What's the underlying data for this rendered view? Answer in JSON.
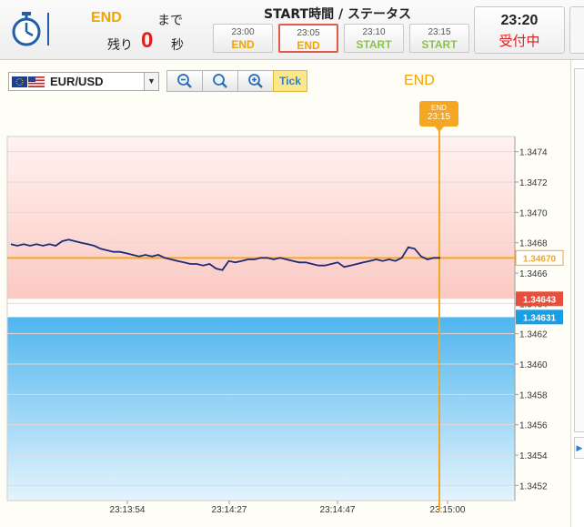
{
  "header": {
    "end_label": "END",
    "made": "まで",
    "nokori": "残り",
    "countdown": "0",
    "byou": "秒",
    "status_heading": "START時間 / ステータス",
    "slots": [
      {
        "time": "23:00",
        "status": "END",
        "kind": "end",
        "selected": false
      },
      {
        "time": "23:05",
        "status": "END",
        "kind": "end",
        "selected": true
      },
      {
        "time": "23:10",
        "status": "START",
        "kind": "start",
        "selected": false
      },
      {
        "time": "23:15",
        "status": "START",
        "kind": "start",
        "selected": false
      }
    ],
    "clock_time": "23:20",
    "clock_status": "受付中"
  },
  "chart_panel": {
    "pair": "EUR/USD",
    "tick_label": "Tick",
    "end_label": "END",
    "end_marker_top": "END",
    "end_marker_time": "23:15"
  },
  "colors": {
    "accent_orange": "#f5a623",
    "down_red": "#e84e3a",
    "up_blue": "#1a9ee3",
    "price_line": "#1e2a78"
  },
  "icons": [
    "stopwatch-icon",
    "zoom-out-icon",
    "zoom-reset-icon",
    "zoom-in-icon",
    "dropdown-arrow-icon",
    "us-flag-icon"
  ],
  "chart_data": {
    "type": "line",
    "title": "",
    "xlabel": "",
    "ylabel": "",
    "ylim": [
      1.3451,
      1.3475
    ],
    "yticks": [
      "1.3474",
      "1.3472",
      "1.3470",
      "1.3468",
      "1.3466",
      "1.3464",
      "1.3462",
      "1.3460",
      "1.3458",
      "1.3456",
      "1.3454",
      "1.3452"
    ],
    "xticks": [
      "23:13:54",
      "23:14:27",
      "23:14:47",
      "23:15:00"
    ],
    "current_price": "1.34670",
    "low_line_label": "1.34643",
    "high_line_label": "1.34631",
    "strike": 1.3467,
    "low_line": 1.34643,
    "high_line": 1.34631,
    "series": [
      {
        "values": [
          1.34679,
          1.34678,
          1.34679,
          1.34678,
          1.34679,
          1.34678,
          1.34679,
          1.34678,
          1.34681,
          1.34682,
          1.34681,
          1.3468,
          1.34679,
          1.34678,
          1.34676,
          1.34675,
          1.34674,
          1.34674,
          1.34673,
          1.34672,
          1.34671,
          1.34672,
          1.34671,
          1.34672,
          1.3467,
          1.34669,
          1.34668,
          1.34667,
          1.34666,
          1.34666,
          1.34665,
          1.34666,
          1.34663,
          1.34662,
          1.34668,
          1.34667,
          1.34668,
          1.34669,
          1.34669,
          1.3467,
          1.3467,
          1.34669,
          1.3467,
          1.34669,
          1.34668,
          1.34667,
          1.34667,
          1.34666,
          1.34665,
          1.34665,
          1.34666,
          1.34667,
          1.34664,
          1.34665,
          1.34666,
          1.34667,
          1.34668,
          1.34669,
          1.34668,
          1.34669,
          1.34668,
          1.3467,
          1.34677,
          1.34676,
          1.34671,
          1.34669,
          1.3467,
          1.3467
        ]
      }
    ]
  }
}
